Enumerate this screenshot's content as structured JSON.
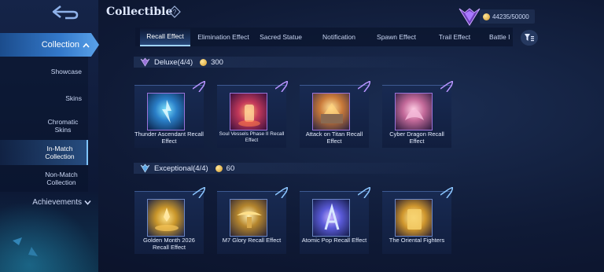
{
  "header": {
    "title": "Collectible",
    "currency_value": "44235/50000",
    "currency_icon": "coin-icon",
    "help_icon": "help-diamond-icon",
    "rank_icon": "rank-emblem-icon"
  },
  "sidebar": {
    "collection_label": "Collection",
    "items": [
      {
        "label": "Showcase",
        "icon": ""
      },
      {
        "label": "Skins",
        "icon": ""
      },
      {
        "label": "Chromatic Skins",
        "icon": ""
      },
      {
        "label": "In-Match Collection",
        "icon": "",
        "active": true
      },
      {
        "label": "Non-Match Collection",
        "icon": ""
      }
    ],
    "achievements_label": "Achievements"
  },
  "tabs": [
    {
      "label": "Recall Effect",
      "active": true
    },
    {
      "label": "Elimination Effect"
    },
    {
      "label": "Sacred Statue"
    },
    {
      "label": "Notification"
    },
    {
      "label": "Spawn Effect"
    },
    {
      "label": "Trail Effect"
    },
    {
      "label": "Battle I"
    }
  ],
  "sections": [
    {
      "name": "Deluxe(4/4)",
      "points": "300",
      "accent": "#9a74d9",
      "cards": [
        {
          "label": "Thunder Ascendant Recall Effect"
        },
        {
          "label": "Soul Vessels Phase II Recall Effect"
        },
        {
          "label": "Attack on Titan Recall Effect"
        },
        {
          "label": "Cyber Dragon Recall Effect"
        }
      ]
    },
    {
      "name": "Exceptional(4/4)",
      "points": "60",
      "accent": "#5fa8e6",
      "cards": [
        {
          "label": "Golden Month 2026 Recall Effect"
        },
        {
          "label": "M7 Glory Recall Effect"
        },
        {
          "label": "Atomic Pop Recall Effect"
        },
        {
          "label": "The Oriental Fighters"
        }
      ]
    }
  ]
}
